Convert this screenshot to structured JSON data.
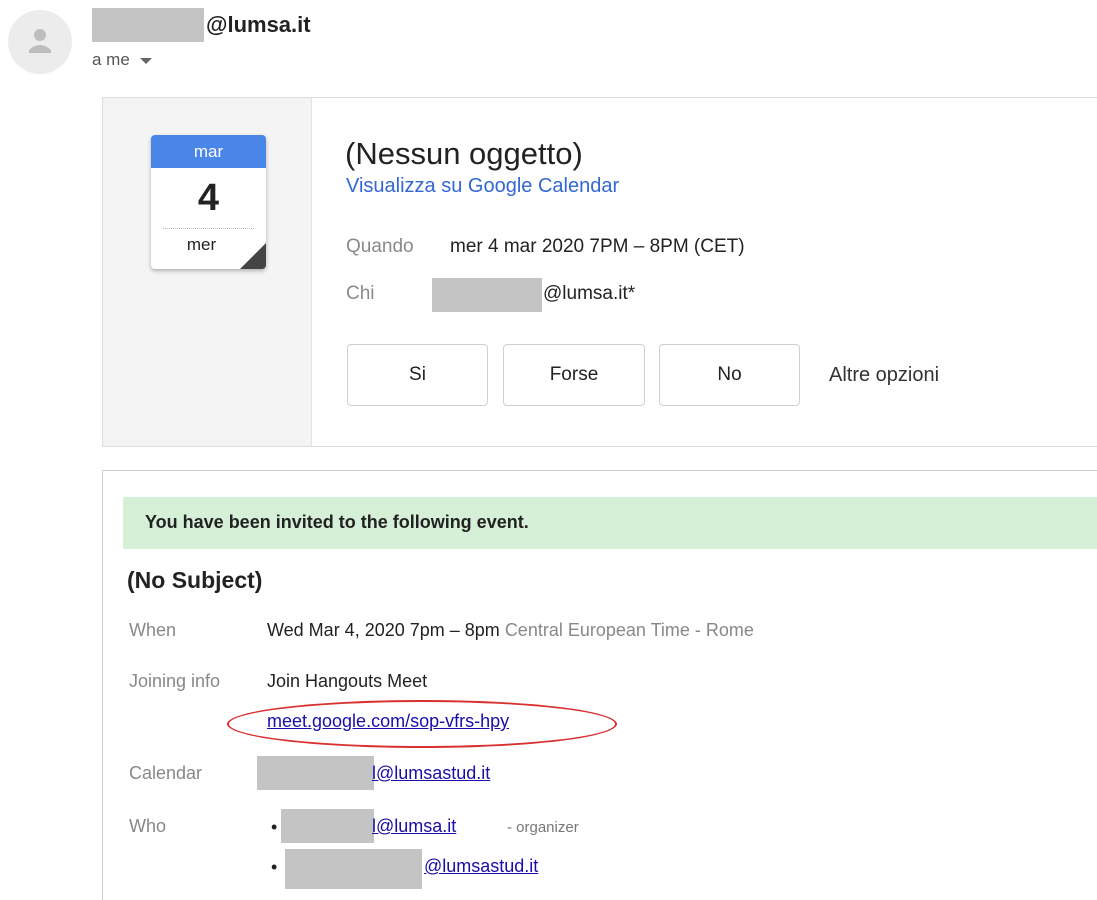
{
  "header": {
    "sender_domain": "@lumsa.it",
    "recipient": "a me"
  },
  "invite": {
    "calendar_icon": {
      "month": "mar",
      "day": "4",
      "weekday": "mer"
    },
    "title": "(Nessun oggetto)",
    "calendar_link": "Visualizza su Google Calendar",
    "when_label": "Quando",
    "when_value": "mer 4 mar 2020 7PM – 8PM (CET)",
    "who_label": "Chi",
    "who_value": "@lumsa.it*",
    "rsvp": {
      "yes": "Si",
      "maybe": "Forse",
      "no": "No",
      "more": "Altre opzioni"
    }
  },
  "body": {
    "banner": "You have been invited to the following event.",
    "subject": "(No Subject)",
    "when_label": "When",
    "when_value": "Wed Mar 4, 2020 7pm – 8pm",
    "when_tz": "Central European Time - Rome",
    "joining_label": "Joining info",
    "joining_value": "Join Hangouts Meet",
    "meet_link": "meet.google.com/sop-vfrs-hpy",
    "calendar_label": "Calendar",
    "calendar_value": "l@lumsastud.it",
    "who_label": "Who",
    "bullet": "•",
    "attendees": [
      {
        "email": "l@lumsa.it",
        "role": "- organizer"
      },
      {
        "email": "@lumsastud.it",
        "role": ""
      }
    ]
  },
  "colors": {
    "calendar_blue": "#4a86e8",
    "link_blue": "#3367d6",
    "banner_green": "#d6f0d8",
    "annotation_red": "#d93030",
    "redaction_gray": "#c4c4c4"
  }
}
